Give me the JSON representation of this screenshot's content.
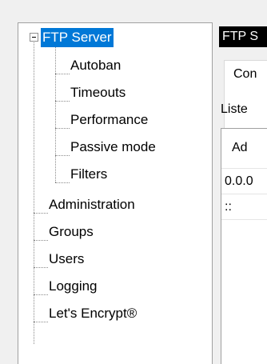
{
  "tree": {
    "root": {
      "label": "FTP Server",
      "selected": true
    },
    "children": [
      {
        "label": "Autoban"
      },
      {
        "label": "Timeouts"
      },
      {
        "label": "Performance"
      },
      {
        "label": "Passive mode"
      },
      {
        "label": "Filters"
      }
    ],
    "siblings": [
      {
        "label": "Administration"
      },
      {
        "label": "Groups"
      },
      {
        "label": "Users"
      },
      {
        "label": "Logging"
      },
      {
        "label": "Let's Encrypt®"
      }
    ]
  },
  "content": {
    "header": "FTP S",
    "tab_label": "Con",
    "listen_label": "Liste",
    "column_header": "Ad",
    "rows": [
      "0.0.0",
      "::"
    ]
  },
  "colors": {
    "selection": "#0078d7",
    "header_bg": "#000000"
  }
}
